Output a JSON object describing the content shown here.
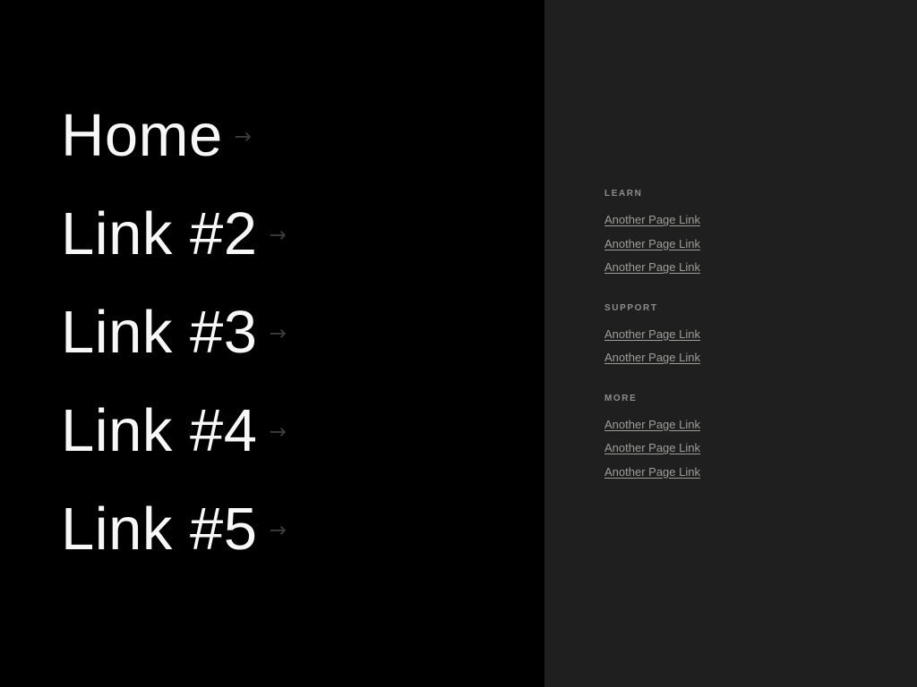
{
  "colors": {
    "primary_panel_bg": "#000000",
    "secondary_panel_bg": "#1f1f1f",
    "primary_link_text": "#f7f7f7",
    "primary_arrow": "#3c3c3c",
    "group_heading_text": "#8d8d8a",
    "group_link_text": "#9d9d99"
  },
  "primary_nav": {
    "items": [
      {
        "label": "Home",
        "arrow": "→",
        "arrow_icon": "arrow-right-icon"
      },
      {
        "label": "Link #2",
        "arrow": "→",
        "arrow_icon": "arrow-right-icon"
      },
      {
        "label": "Link #3",
        "arrow": "→",
        "arrow_icon": "arrow-right-icon"
      },
      {
        "label": "Link #4",
        "arrow": "→",
        "arrow_icon": "arrow-right-icon"
      },
      {
        "label": "Link #5",
        "arrow": "→",
        "arrow_icon": "arrow-right-icon"
      }
    ]
  },
  "secondary_nav": {
    "groups": [
      {
        "heading": "LEARN",
        "links": [
          {
            "label": "Another Page Link"
          },
          {
            "label": "Another Page Link"
          },
          {
            "label": "Another Page Link"
          }
        ]
      },
      {
        "heading": "SUPPORT",
        "links": [
          {
            "label": "Another Page Link"
          },
          {
            "label": "Another Page Link"
          }
        ]
      },
      {
        "heading": "MORE",
        "links": [
          {
            "label": "Another Page Link"
          },
          {
            "label": "Another Page Link"
          },
          {
            "label": "Another Page Link"
          }
        ]
      }
    ]
  }
}
